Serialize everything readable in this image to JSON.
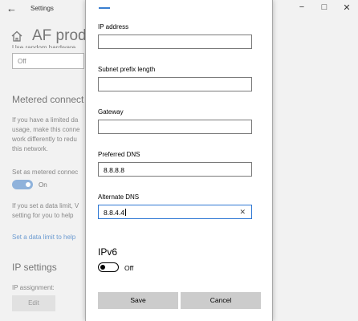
{
  "window": {
    "title": "Settings",
    "page_title": "AF produ",
    "minimize_icon": "minimize-icon",
    "maximize_icon": "maximize-icon",
    "close_icon": "close-icon"
  },
  "background": {
    "dropdown_value": "Off",
    "metered_heading": "Metered connect",
    "metered_para": [
      "If you have a limited da",
      "usage, make this conne",
      "work differently to redu",
      "this network."
    ],
    "set_metered_label": "Set as metered connec",
    "metered_toggle_label": "On",
    "data_limit_para": [
      "If you set a data limit, V",
      "setting for you to help"
    ],
    "data_limit_link": "Set a data limit to help",
    "ip_settings_heading": "IP settings",
    "ip_assignment_label": "IP assignment:",
    "edit_button": "Edit"
  },
  "dialog": {
    "fields": {
      "ip_address": {
        "label": "IP address",
        "value": ""
      },
      "subnet": {
        "label": "Subnet prefix length",
        "value": ""
      },
      "gateway": {
        "label": "Gateway",
        "value": ""
      },
      "preferred_dns": {
        "label": "Preferred DNS",
        "value": "8.8.8.8"
      },
      "alternate_dns": {
        "label": "Alternate DNS",
        "value": "8.8.4.4"
      }
    },
    "ipv6_heading": "IPv6",
    "ipv6_toggle_state": "Off",
    "save_label": "Save",
    "cancel_label": "Cancel",
    "clear_icon": "✕"
  },
  "colors": {
    "accent": "#2f78d4",
    "button_bg": "#cccccc",
    "background_window": "#f2f2f2"
  }
}
